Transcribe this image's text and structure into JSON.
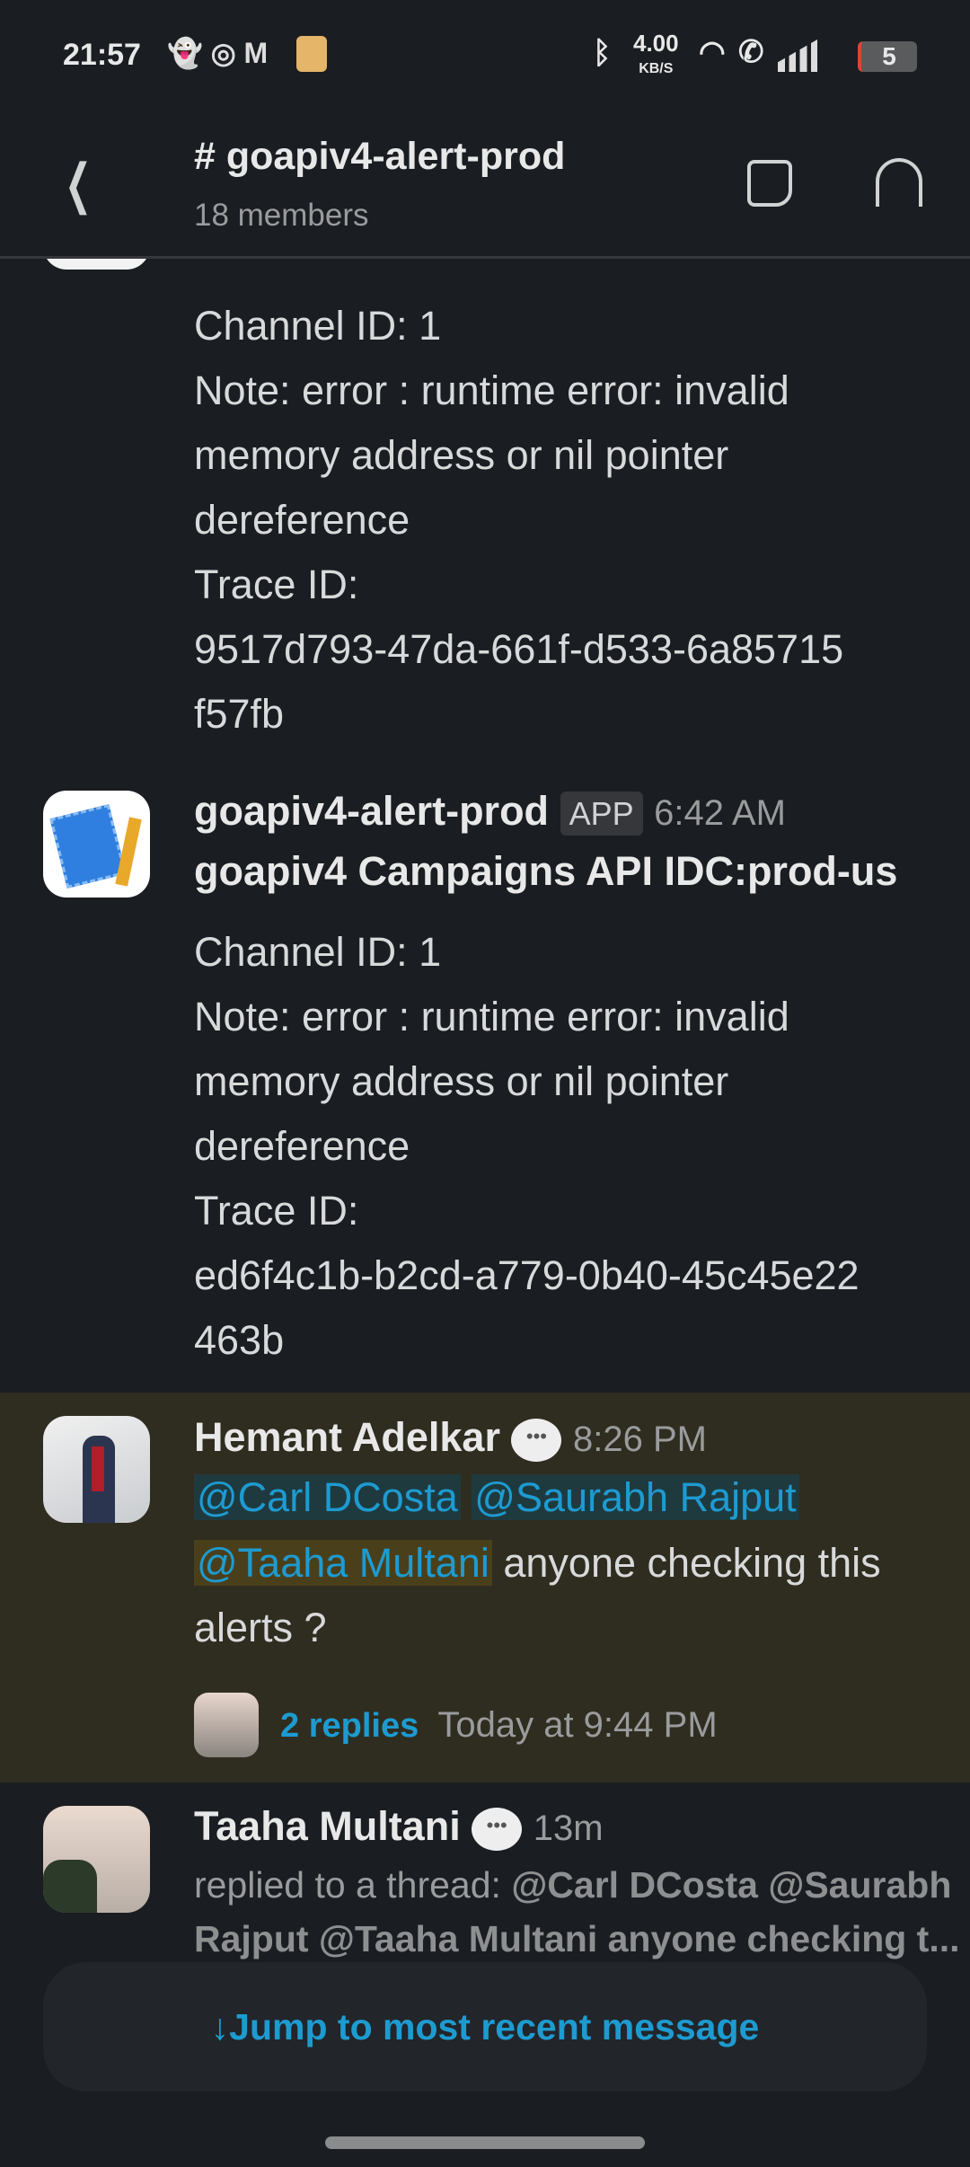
{
  "status_bar": {
    "time": "21:57",
    "net_speed": "4.00",
    "net_unit": "KB/S",
    "battery": "5",
    "icons": [
      "snapchat-icon",
      "instagram-icon",
      "gmail-icon",
      "amazon-icon",
      "bluetooth-icon",
      "wifi-icon",
      "wifi-call-icon",
      "signal-icon",
      "battery-icon"
    ]
  },
  "header": {
    "back_icon": "chevron-left-icon",
    "title": "# goapiv4-alert-prod",
    "subtitle": "18 members",
    "actions": [
      "new-canvas-icon",
      "headphones-icon"
    ]
  },
  "messages": [
    {
      "partial": true,
      "lines": [
        "Channel ID: 1",
        "Note: error : runtime error: invalid",
        "memory address or nil pointer",
        "dereference",
        "Trace ID:",
        "9517d793-47da-661f-d533-6a85715",
        "f57fb"
      ]
    },
    {
      "author": "goapiv4-alert-prod",
      "badge": "APP",
      "time": "6:42 AM",
      "title": "goapiv4 Campaigns API IDC:prod-us",
      "lines": [
        "Channel ID: 1",
        "Note: error : runtime error: invalid",
        "memory address or nil pointer",
        "dereference",
        "Trace ID:",
        "ed6f4c1b-b2cd-a779-0b40-45c45e22",
        "463b"
      ]
    },
    {
      "author": "Hemant Adelkar",
      "time": "8:26 PM",
      "highlighted": true,
      "mentions": [
        "@Carl DCosta",
        "@Saurabh Rajput",
        "@Taaha Multani"
      ],
      "text_after": "anyone checking this",
      "text_line3": "alerts ?",
      "replies": "2 replies",
      "replies_time": "Today at 9:44 PM"
    },
    {
      "author": "Taaha Multani",
      "time": "13m",
      "prefix": "replied to a thread:",
      "preview_1": "@Carl DCosta @Saurabh",
      "preview_2": "Rajput @Taaha Multani anyone checking t..."
    }
  ],
  "jump_button": {
    "label": "Jump to most recent message",
    "icon": "arrow-down-icon"
  },
  "colors": {
    "background": "#1a1d21",
    "link": "#1d9bd1",
    "highlight": "#2f2d20"
  }
}
